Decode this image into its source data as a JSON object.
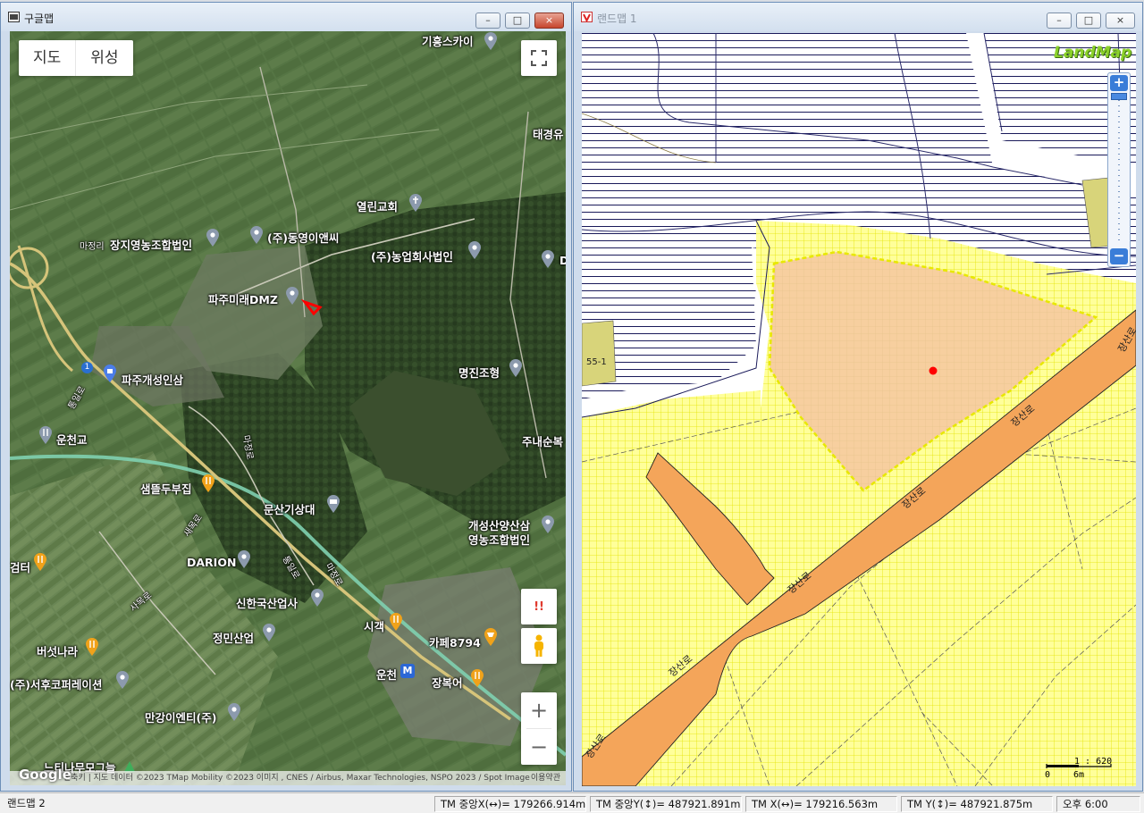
{
  "left_window": {
    "title": "구글맵",
    "controls": {
      "minimize": "–",
      "maximize": "□",
      "close": "×"
    },
    "map_type": {
      "map": "지도",
      "satellite": "위성"
    },
    "labels": {
      "gihung": "기흥스카이",
      "taegyeong": "태경유",
      "yeollin": "열린교회",
      "majeongri": "마정리",
      "jangji": "장지영농조합법인",
      "dongyoung": "(주)동영이앤씨",
      "nongeop": "(주)농업회사법인",
      "d_right": "D",
      "paju_mirae": "파주미래DMZ",
      "paju_gaeseong": "파주개성인삼",
      "myeongjin": "명진조형",
      "uncheongyo": "운천교",
      "junaesun": "주내순복",
      "saemtteul": "샘뜰두부집",
      "munsan": "문산기상대",
      "gaeseong_l1": "개성산양산삼",
      "gaeseong_l2": "영농조합법인",
      "darion": "DARION",
      "geomteo": "검터",
      "shinhan": "신한국산업사",
      "sigak": "시객",
      "cafe": "카페8794",
      "jeongmin": "정민산업",
      "beoseot": "버섯나라",
      "seohu": "(주)서후코퍼레이션",
      "uncheon": "운천",
      "jangbogeo": "장복어",
      "mangang": "만강이엔티(주)",
      "neuti": "느티나무모그늘",
      "road_tongil_1": "통일로",
      "road_tongil_2": "통일로",
      "road_majeong_1": "마정로",
      "road_majeong_2": "마정로",
      "road_saemok": "새목로",
      "road_sarok": "사목로",
      "road_1": "1"
    },
    "attribution": "단축키 | 지도 데이터 ©2023 TMap Mobility ©2023 이미지 , CNES / Airbus, Maxar Technologies, NSPO 2023 / Spot Image",
    "terms": "이용약관",
    "google": "Google",
    "report_glyph": "!!",
    "zoom_in": "+",
    "zoom_out": "−",
    "colors": {
      "satellite_base": "#3e5a34",
      "road": "#d6c47a",
      "railway": "#7fd0b0",
      "parcel_highlight": "#ff0000"
    }
  },
  "right_window": {
    "title": "랜드맵 1",
    "controls": {
      "minimize": "–",
      "maximize": "□",
      "close": "×"
    },
    "logo": "LandMap",
    "zoom_plus": "+",
    "zoom_minus": "−",
    "parcel_label": "55-1",
    "roads": [
      "장산로",
      "장산로",
      "장산로",
      "장산로",
      "장산로",
      "장산로"
    ],
    "scale_ratio": "1 : 620",
    "scale_zero": "0",
    "scale_len": "6m",
    "colors": {
      "parcel_fill": "#f7cf9f",
      "road_fill": "#f4a55a",
      "zone_yellow": "#ffff9a",
      "grid_line": "#e6e600",
      "hatch": "#1a1a5a",
      "point": "#ff0000"
    }
  },
  "status_bar": {
    "app": "랜드맵 2",
    "tm_center_x": "TM 중앙X(↔)= 179266.914m",
    "tm_center_y": "TM 중앙Y(↕)= 487921.891m",
    "tm_x": "TM X(↔)= 179216.563m",
    "tm_y": "TM Y(↕)= 487921.875m",
    "time": "오후 6:00"
  }
}
